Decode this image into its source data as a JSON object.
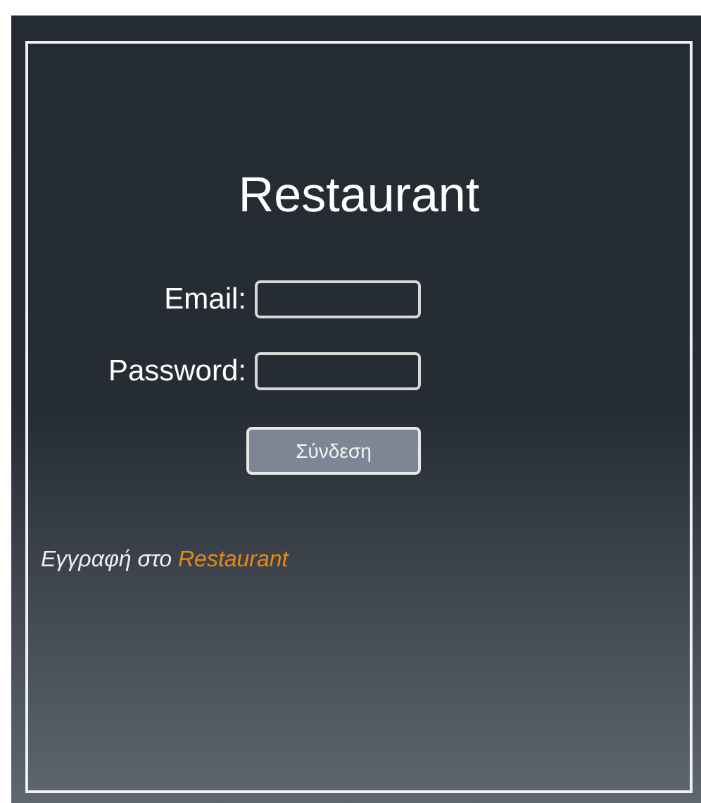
{
  "title": "Restaurant",
  "fields": [
    {
      "label": "Email:"
    },
    {
      "label": "Password:"
    }
  ],
  "submit": "Σύνδεση",
  "register": {
    "text": "Εγγραφή στο",
    "link": "Restaurant"
  }
}
